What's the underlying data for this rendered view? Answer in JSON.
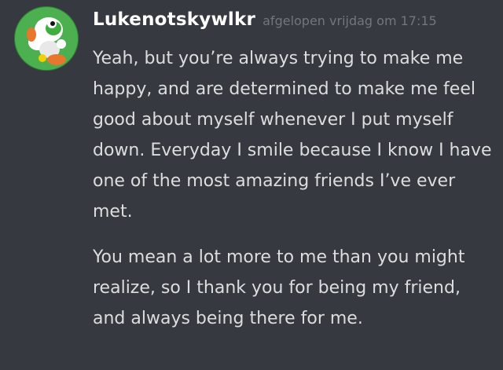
{
  "message": {
    "author": "Lukenotskywlkr",
    "timestamp": "afgelopen vrijdag om 17:15",
    "avatar_icon": "yoshi-avatar-icon",
    "paragraphs": [
      "Yeah, but you’re always trying  to make me happy, and are determined to make me feel good about myself whenever I put myself down. Everyday I smile because I know I have one of the most amazing friends I’ve ever met.",
      "You mean a lot more to me than you might realize, so I thank you for being my friend, and always being there for me."
    ]
  },
  "colors": {
    "background": "#36393f",
    "author": "#ffffff",
    "timestamp": "#72767d",
    "text": "#dcddde"
  }
}
